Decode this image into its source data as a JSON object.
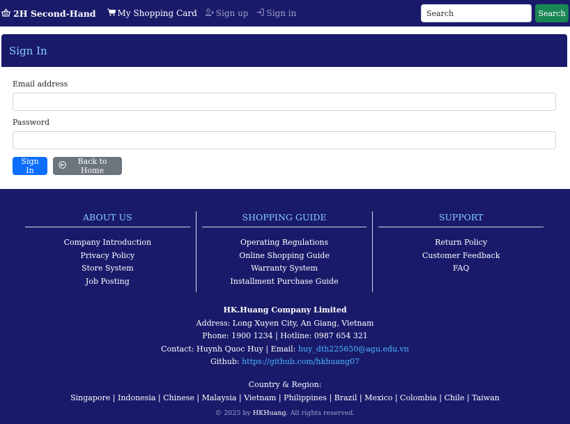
{
  "navbar": {
    "brand": "2H Second-Hand",
    "links": [
      {
        "label": "My Shopping Card",
        "icon": "cart-icon"
      },
      {
        "label": "Sign up",
        "icon": "user-plus-icon"
      },
      {
        "label": "Sign in",
        "icon": "sign-in-icon"
      }
    ],
    "search_placeholder": "Search",
    "search_button": "Search"
  },
  "signin": {
    "title": "Sign In",
    "email_label": "Email address",
    "email_value": "",
    "password_label": "Password",
    "password_value": "",
    "submit_label": "Sign In",
    "back_label": "Back to Home"
  },
  "footer": {
    "columns": [
      {
        "title": "ABOUT US",
        "items": [
          "Company Introduction",
          "Privacy Policy",
          "Store System",
          "Job Posting"
        ]
      },
      {
        "title": "SHOPPING GUIDE",
        "items": [
          "Operating Regulations",
          "Online Shopping Guide",
          "Warranty System",
          "Installment Purchase Guide"
        ]
      },
      {
        "title": "SUPPORT",
        "items": [
          "Return Policy",
          "Customer Feedback",
          "FAQ"
        ]
      }
    ],
    "company_name": "HK.Huang Company Limited",
    "address": "Address: Long Xuyen City, An Giang, Vietnam",
    "phone": "Phone: 1900 1234 | Hotline: 0987 654 321",
    "contact_prefix": "Contact: Huynh Quoc Huy | Email: ",
    "email": "huy_dth225650@agu.edu.vn",
    "github_prefix": "Github: ",
    "github": "https://github.com/hkhuang07",
    "region_label": "Country & Region:",
    "regions": "Singapore | Indonesia | Chinese | Malaysia | Vietnam | Philippines | Brazil | Mexico | Colombia | Chile | Taiwan",
    "copyright_prefix": "© 2025 by ",
    "copyright_owner": "HKHuang",
    "copyright_suffix": ". All rights reserved."
  },
  "colors": {
    "navy": "#1a1a6b",
    "title_blue": "#87cefa",
    "primary": "#0d6efd",
    "success": "#198754",
    "secondary": "#6c757d",
    "link": "#4ab8ff"
  }
}
